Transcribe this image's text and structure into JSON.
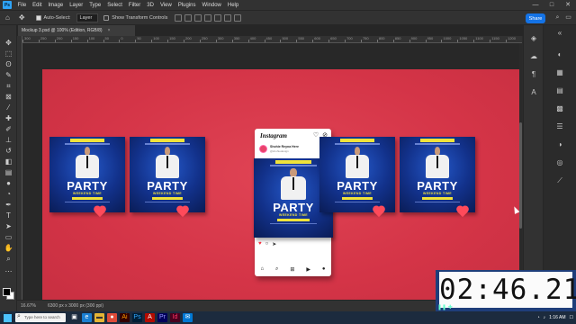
{
  "app": {
    "logo_text": "Ps",
    "menu": [
      "File",
      "Edit",
      "Image",
      "Layer",
      "Type",
      "Select",
      "Filter",
      "3D",
      "View",
      "Plugins",
      "Window",
      "Help"
    ],
    "window_controls": [
      "—",
      "□",
      "✕"
    ]
  },
  "options": {
    "move_icon": "move-icon",
    "auto_select_label": "Auto-Select:",
    "layer_select_value": "Layer",
    "transform_label": "Show Transform Controls",
    "share_label": "Share"
  },
  "document": {
    "tab_title": "Mockup 3.psd @ 100% (Edition, RGB/8)",
    "close": "×"
  },
  "ruler_ticks": [
    "300",
    "250",
    "200",
    "150",
    "100",
    "50",
    "0",
    "50",
    "100",
    "150",
    "200",
    "250",
    "300",
    "350",
    "400",
    "450",
    "500",
    "550",
    "600",
    "650",
    "700",
    "750",
    "800",
    "850",
    "900",
    "950",
    "1000",
    "1050",
    "1100",
    "1150",
    "1200"
  ],
  "posters": {
    "title": "PARTY",
    "subtitle": "WEEKEND TIME"
  },
  "phone": {
    "logo": "Instagram",
    "account_name": "Shohie Reyna Here",
    "account_sub": "@shohiedesign"
  },
  "status": {
    "zoom": "16.67%",
    "dimensions": "6300 px x 3000 px (300 ppi)"
  },
  "timer": {
    "value": "02:46.21"
  },
  "taskbar": {
    "search_placeholder": "Type here to search",
    "time": "1:16 AM"
  },
  "colors": {
    "accent": "#1473e6",
    "canvas_bg": "#d93a4b",
    "poster_blue": "#12318a",
    "heart": "#ff4a5a"
  }
}
